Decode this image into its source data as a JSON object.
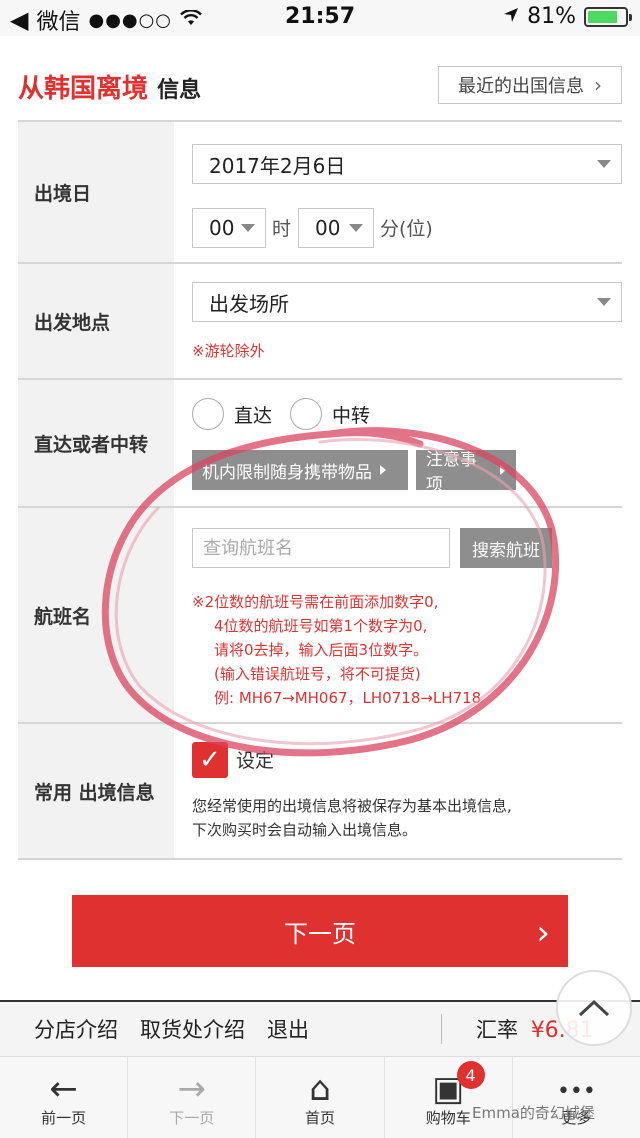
{
  "status_bar": {
    "back": "◀",
    "app": "微信",
    "signal": "●●●○○",
    "time": "21:57",
    "battery": "81%"
  },
  "header": {
    "title_red": "从韩国离境",
    "title_black": "信息",
    "recent_button": "最近的出国信息"
  },
  "form": {
    "departure_date": {
      "label": "出境日",
      "date": "2017年2月6日",
      "hour": "00",
      "hour_unit": "时",
      "minute": "00",
      "minute_unit": "分(位)"
    },
    "departure_place": {
      "label": "出发地点",
      "value": "出发场所",
      "note": "※游轮除外"
    },
    "route": {
      "label": "直达或者中转",
      "option_direct": "直达",
      "option_transfer": "中转",
      "btn_cabin": "机内限制随身携带物品",
      "btn_notice": "注意事项"
    },
    "flight": {
      "label": "航班名",
      "placeholder": "查询航班名",
      "search_button": "搜索航班",
      "notes": [
        "※2位数的航班号需在前面添加数字0,",
        "4位数的航班号如第1个数字为0,",
        "请将0去掉，输入后面3位数字。",
        "(输入错误航班号，将不可提货)",
        "例: MH67→MH067，LH0718→LH718"
      ]
    },
    "saved": {
      "label": "常用 出境信息",
      "checkbox_label": "设定",
      "desc_line1": "您经常使用的出境信息将被保存为基本出境信息,",
      "desc_line2": "下次购买时会自动输入出境信息。"
    }
  },
  "next_button": "下一页",
  "links": {
    "store": "分店介绍",
    "pickup": "取货处介绍",
    "logout": "退出",
    "rate_label": "汇率",
    "rate_value": "¥6.81"
  },
  "tabs": [
    {
      "label": "前一页",
      "icon": "←"
    },
    {
      "label": "下一页",
      "icon": "→"
    },
    {
      "label": "首页",
      "icon": "⌂"
    },
    {
      "label": "购物车",
      "icon": "▣",
      "badge": "4"
    },
    {
      "label": "更多",
      "icon": "•••"
    }
  ],
  "watermark": "Emma的奇幻城堡",
  "colors": {
    "accent": "#e03131",
    "label_bg": "#f2f2f2",
    "gray_button": "#8e8e8e"
  }
}
